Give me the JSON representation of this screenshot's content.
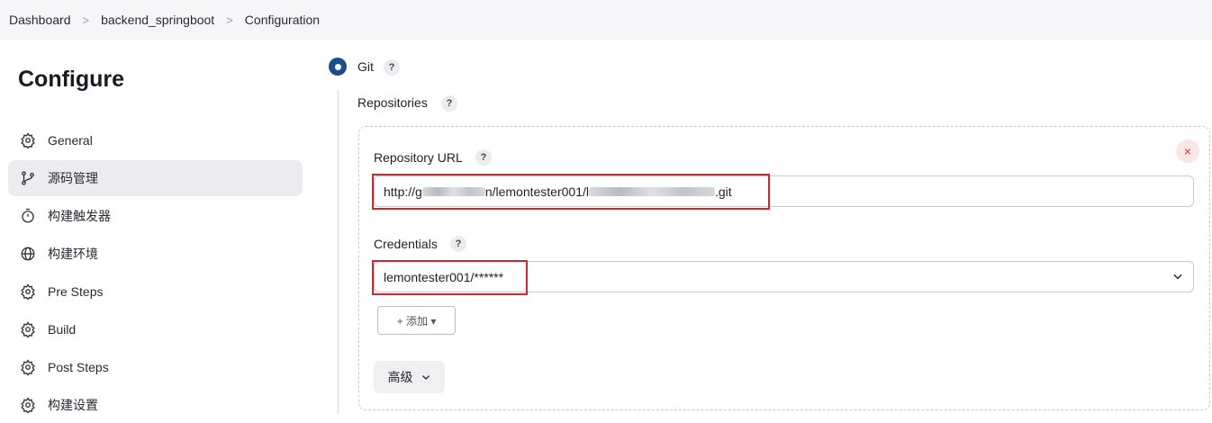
{
  "breadcrumb": {
    "items": [
      "Dashboard",
      "backend_springboot",
      "Configuration"
    ],
    "separator": ">"
  },
  "sidebar": {
    "title": "Configure",
    "items": [
      {
        "label": "General",
        "icon": "gear-icon"
      },
      {
        "label": "源码管理",
        "icon": "branch-icon",
        "active": true
      },
      {
        "label": "构建触发器",
        "icon": "timer-icon"
      },
      {
        "label": "构建环境",
        "icon": "globe-icon"
      },
      {
        "label": "Pre Steps",
        "icon": "gear-icon"
      },
      {
        "label": "Build",
        "icon": "gear-icon"
      },
      {
        "label": "Post Steps",
        "icon": "gear-icon"
      },
      {
        "label": "构建设置",
        "icon": "gear-icon"
      }
    ]
  },
  "scm": {
    "option_label": "Git",
    "help": "?",
    "repositories_label": "Repositories",
    "repository": {
      "url_label": "Repository URL",
      "url_prefix": "http://g",
      "url_middle": "n/lemontester001/l",
      "url_suffix": ".git",
      "credentials_label": "Credentials",
      "credentials_value": "lemontester001/******",
      "add_button": "+ 添加 ▾",
      "advanced_button": "高级",
      "remove": "×"
    }
  },
  "colors": {
    "accent": "#1b4d8a",
    "highlight": "#d0262e",
    "active_bg": "#ececf0"
  }
}
